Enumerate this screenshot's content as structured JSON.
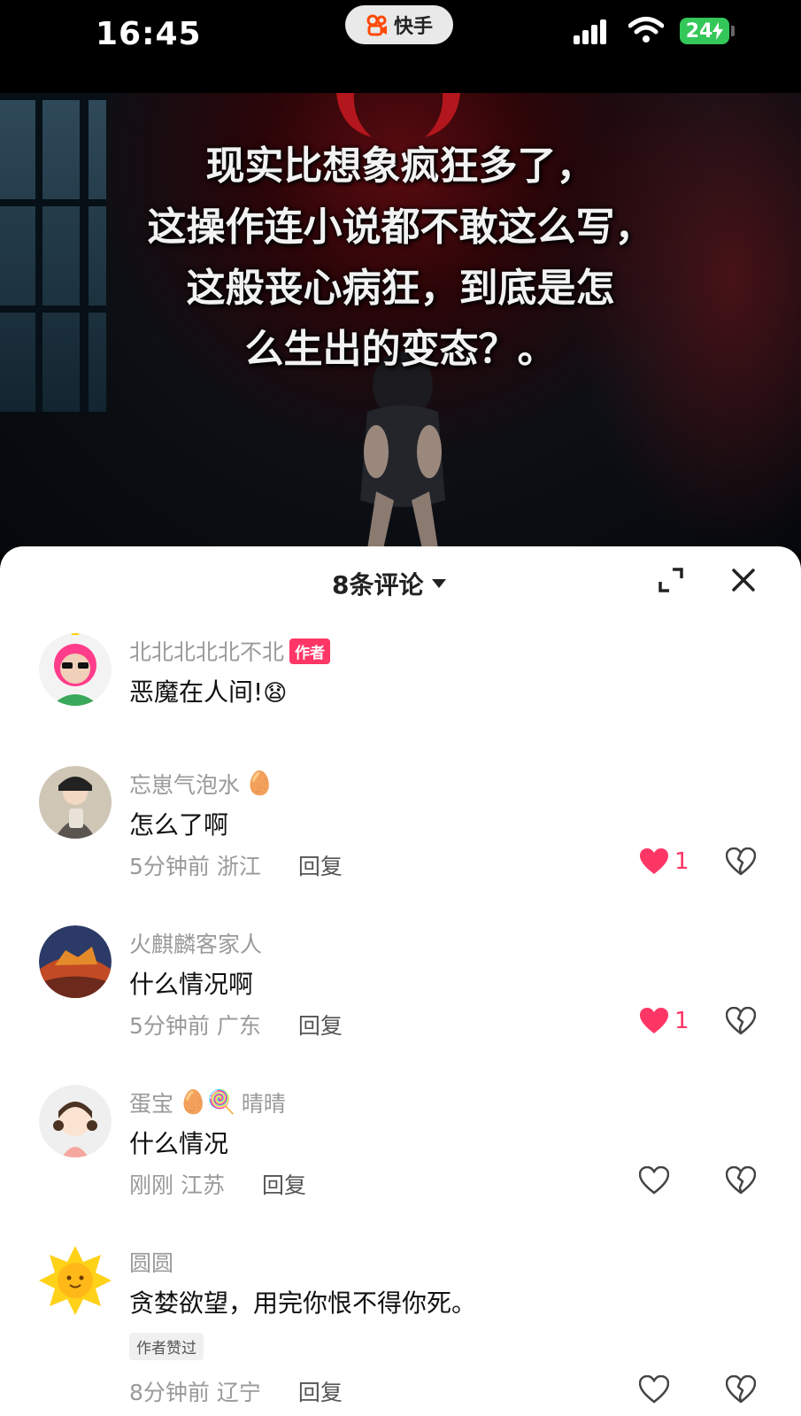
{
  "status_bar": {
    "time": "16:45",
    "app_name": "快手",
    "battery": "24"
  },
  "hero": {
    "headline_lines": [
      "现实比想象疯狂多了，",
      "这操作连小说都不敢这么写，",
      "这般丧心病狂，到底是怎",
      "么生出的变态？。"
    ]
  },
  "comments_panel": {
    "title": "8条评论",
    "comments": [
      {
        "name": "北北北北北不北",
        "badge": "作者",
        "text": "恶魔在人间!",
        "emoji": "😧"
      },
      {
        "name": "忘崽气泡水",
        "name_emoji": "🥚",
        "text": "怎么了啊",
        "time": "5分钟前",
        "location": "浙江",
        "reply": "回复",
        "likes": "1"
      },
      {
        "name": "火麒麟客家人",
        "text": "什么情况啊",
        "time": "5分钟前",
        "location": "广东",
        "reply": "回复",
        "likes": "1"
      },
      {
        "name_prefix": "蛋宝",
        "name_emoji": "🥚🍭",
        "name_suffix": "晴晴",
        "text": "什么情况",
        "time": "刚刚",
        "location": "江苏",
        "reply": "回复"
      },
      {
        "name": "圆圆",
        "text": "贪婪欲望，用完你恨不得你死。",
        "tag": "作者赞过",
        "time": "8分钟前",
        "location": "辽宁",
        "reply": "回复"
      }
    ]
  },
  "colors": {
    "accent": "#fe3666",
    "secondary_text": "#9a9a9a"
  }
}
